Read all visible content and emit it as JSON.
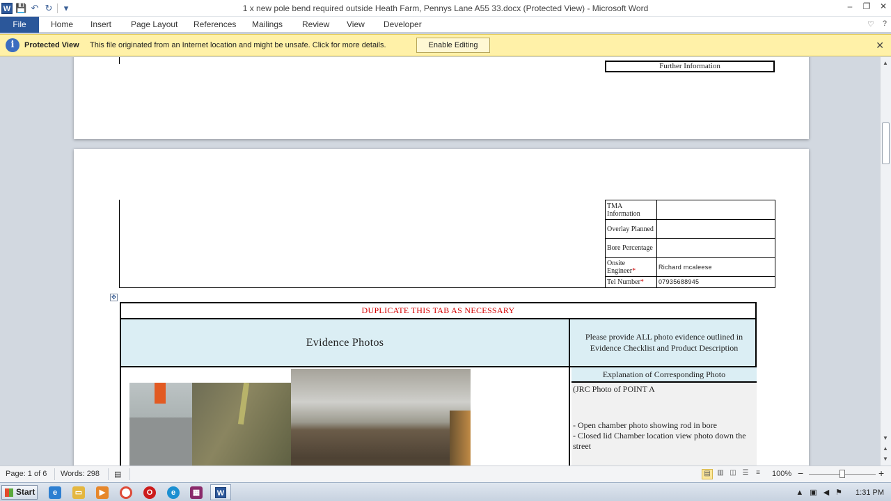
{
  "window": {
    "title": "1 x new pole bend required outside Heath Farm, Pennys Lane A55 33.docx (Protected View)  -  Microsoft Word",
    "controls": {
      "minimize": "–",
      "restore": "❐",
      "close": "✕"
    }
  },
  "quick_access": {
    "app_icon": "W",
    "save": "💾",
    "undo": "↶",
    "redo": "↻",
    "customize": "▾"
  },
  "ribbon": {
    "tabs": [
      "File",
      "Home",
      "Insert",
      "Page Layout",
      "References",
      "Mailings",
      "Review",
      "View",
      "Developer"
    ],
    "minimize_ribbon": "♡",
    "help": "?"
  },
  "protected_view": {
    "icon": "i",
    "title": "Protected View",
    "message": "This file originated from an Internet location and might be unsafe. Click for more details.",
    "button": "Enable Editing",
    "close": "✕"
  },
  "document": {
    "further_information": "Further Information",
    "tma_rows": [
      {
        "label": "TMA Information",
        "value": "",
        "required": false
      },
      {
        "label": "Overlay Planned",
        "value": "",
        "required": false
      },
      {
        "label": "Bore Percentage",
        "value": "",
        "required": false
      },
      {
        "label": "Onsite Engineer",
        "value": "Richard mcaleese",
        "required": true
      },
      {
        "label": "Tel Number",
        "value": "07935688945",
        "required": true
      }
    ],
    "required_mark": "*",
    "table_move_handle": "✥",
    "duplicate_note": "DUPLICATE  THIS TAB AS NECESSARY",
    "evidence_title": "Evidence  Photos",
    "evidence_note": "Please provide ALL  photo evidence outlined in Evidence Checklist  and Product Description",
    "explanation_header": "Explanation  of Corresponding Photo",
    "explanation_lines": [
      "(JRC  Photo of POINT  A",
      "- Open chamber photo showing rod in bore",
      "- Closed lid Chamber location view photo down the street"
    ]
  },
  "status_bar": {
    "page": "Page: 1 of 6",
    "words": "Words: 298",
    "zoom": "100%",
    "zoom_out": "−",
    "zoom_in": "+",
    "zoom_level_fraction": 0.5
  },
  "taskbar": {
    "start": "Start",
    "pinned": [
      "internet-explorer",
      "file-explorer",
      "media-player",
      "chrome",
      "opera",
      "edge",
      "winrar"
    ],
    "active_task": "W",
    "clock": "1:31 PM"
  },
  "colors": {
    "word_blue": "#2b579a",
    "protected_bar": "#fff1a8",
    "table_header_fill": "#dbeef4",
    "duplicate_red": "#d40000"
  }
}
